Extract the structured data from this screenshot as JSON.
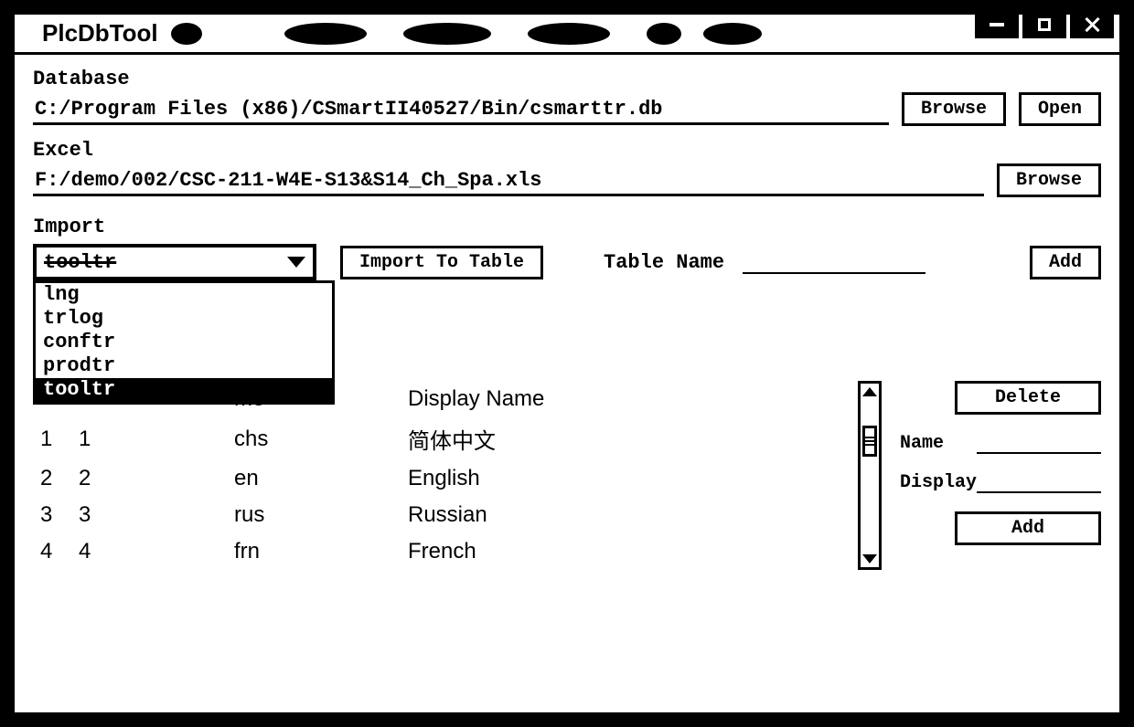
{
  "window": {
    "title": "PlcDbTool"
  },
  "database": {
    "label": "Database",
    "path": "C:/Program Files (x86)/CSmartII40527/Bin/csmarttr.db",
    "browse": "Browse",
    "open": "Open"
  },
  "excel": {
    "label": "Excel",
    "path": "F:/demo/002/CSC-211-W4E-S13&S14_Ch_Spa.xls",
    "browse": "Browse"
  },
  "import": {
    "label": "Import",
    "selected": "tooltr",
    "options": [
      "lng",
      "trlog",
      "conftr",
      "prodtr",
      "tooltr"
    ],
    "import_btn": "Import To Table",
    "table_name_label": "Table Name",
    "table_name_value": "",
    "add": "Add"
  },
  "table": {
    "headers": {
      "col1": "",
      "col2": "me",
      "col3": "Display Name"
    },
    "rows": [
      {
        "idx": "1",
        "id": "1",
        "name": "chs",
        "display": "简体中文"
      },
      {
        "idx": "2",
        "id": "2",
        "name": "en",
        "display": "English"
      },
      {
        "idx": "3",
        "id": "3",
        "name": "rus",
        "display": "Russian"
      },
      {
        "idx": "4",
        "id": "4",
        "name": "frn",
        "display": "French"
      }
    ]
  },
  "side": {
    "delete": "Delete",
    "name_label": "Name",
    "name_value": "",
    "display_label": "Display",
    "display_value": "",
    "add": "Add"
  }
}
